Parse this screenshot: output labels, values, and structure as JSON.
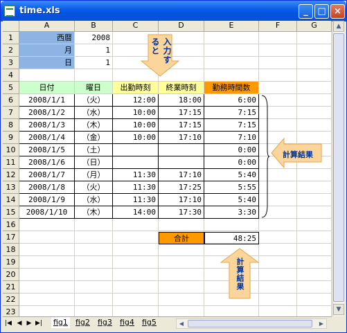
{
  "window": {
    "title": "time.xls",
    "minimize_label": "_",
    "maximize_label": "□",
    "close_label": "×"
  },
  "columns": [
    "A",
    "B",
    "C",
    "D",
    "E",
    "F",
    "G"
  ],
  "rows": [
    "1",
    "2",
    "3",
    "4",
    "5",
    "6",
    "7",
    "8",
    "9",
    "10",
    "11",
    "12",
    "13",
    "14",
    "15",
    "16",
    "17",
    "18",
    "19",
    "20",
    "21",
    "22",
    "23"
  ],
  "inputs": {
    "year_label": "西暦",
    "year_value": "2008",
    "month_label": "月",
    "month_value": "1",
    "day_label": "日",
    "day_value": "1"
  },
  "headers": {
    "date": "日付",
    "weekday": "曜日",
    "start": "出勤時刻",
    "end": "終業時刻",
    "duration": "勤務時間数"
  },
  "table": [
    {
      "date": "2008/1/1",
      "weekday": "（火）",
      "start": "12:00",
      "end": "18:00",
      "duration": "6:00"
    },
    {
      "date": "2008/1/2",
      "weekday": "（水）",
      "start": "10:00",
      "end": "17:15",
      "duration": "7:15"
    },
    {
      "date": "2008/1/3",
      "weekday": "（木）",
      "start": "10:00",
      "end": "17:15",
      "duration": "7:15"
    },
    {
      "date": "2008/1/4",
      "weekday": "（金）",
      "start": "10:00",
      "end": "17:10",
      "duration": "7:10"
    },
    {
      "date": "2008/1/5",
      "weekday": "（土）",
      "start": "",
      "end": "",
      "duration": "0:00"
    },
    {
      "date": "2008/1/6",
      "weekday": "（日）",
      "start": "",
      "end": "",
      "duration": "0:00"
    },
    {
      "date": "2008/1/7",
      "weekday": "（月）",
      "start": "11:30",
      "end": "17:10",
      "duration": "5:40"
    },
    {
      "date": "2008/1/8",
      "weekday": "（火）",
      "start": "11:30",
      "end": "17:25",
      "duration": "5:55"
    },
    {
      "date": "2008/1/9",
      "weekday": "（水）",
      "start": "11:30",
      "end": "17:10",
      "duration": "5:40"
    },
    {
      "date": "2008/1/10",
      "weekday": "（木）",
      "start": "14:00",
      "end": "17:30",
      "duration": "3:30"
    }
  ],
  "total": {
    "label": "合計",
    "value": "48:25"
  },
  "callouts": {
    "input": "入力すると",
    "result_right": "計算結果",
    "result_bottom": "計算結果"
  },
  "tabs": [
    "fig1",
    "fig2",
    "fig3",
    "fig4",
    "fig5"
  ],
  "colors": {
    "blue": "#8db4e2",
    "green": "#ccffcc",
    "yellow": "#ffff99",
    "orange": "#ff9900",
    "callout": "#fcd59a"
  }
}
